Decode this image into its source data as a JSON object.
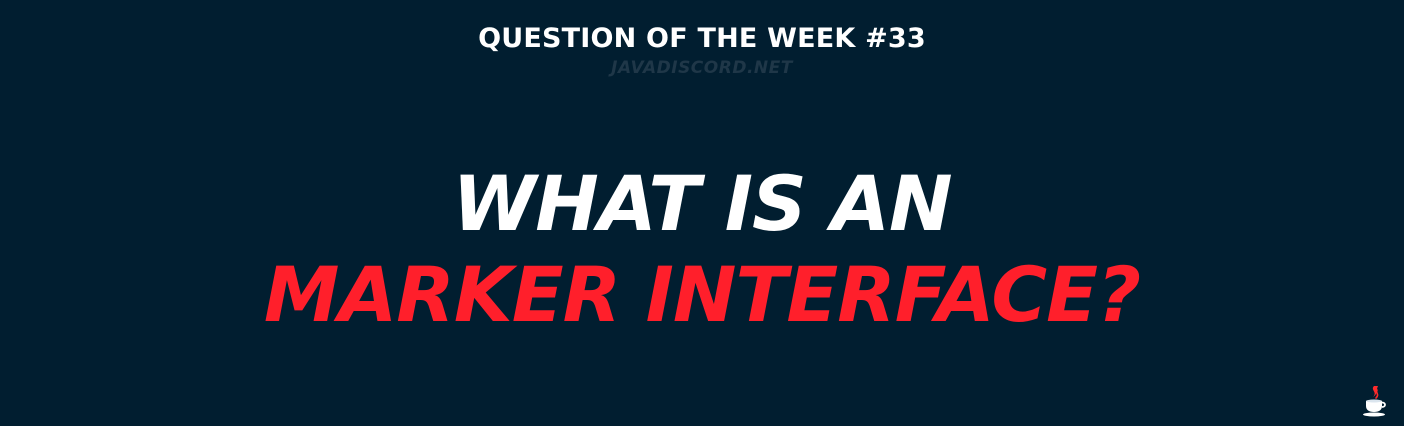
{
  "banner": {
    "series_title": "QUESTION OF THE WEEK #33",
    "website": "JAVADISCORD.NET",
    "headline_line1": "WHAT IS AN",
    "headline_line2": "MARKER INTERFACE?",
    "logo_icon": "java-coffee-cup-icon",
    "colors": {
      "background": "#011e30",
      "primary_text": "#ffffff",
      "accent": "#ff1f2b",
      "muted_text": "#1f3748"
    }
  }
}
